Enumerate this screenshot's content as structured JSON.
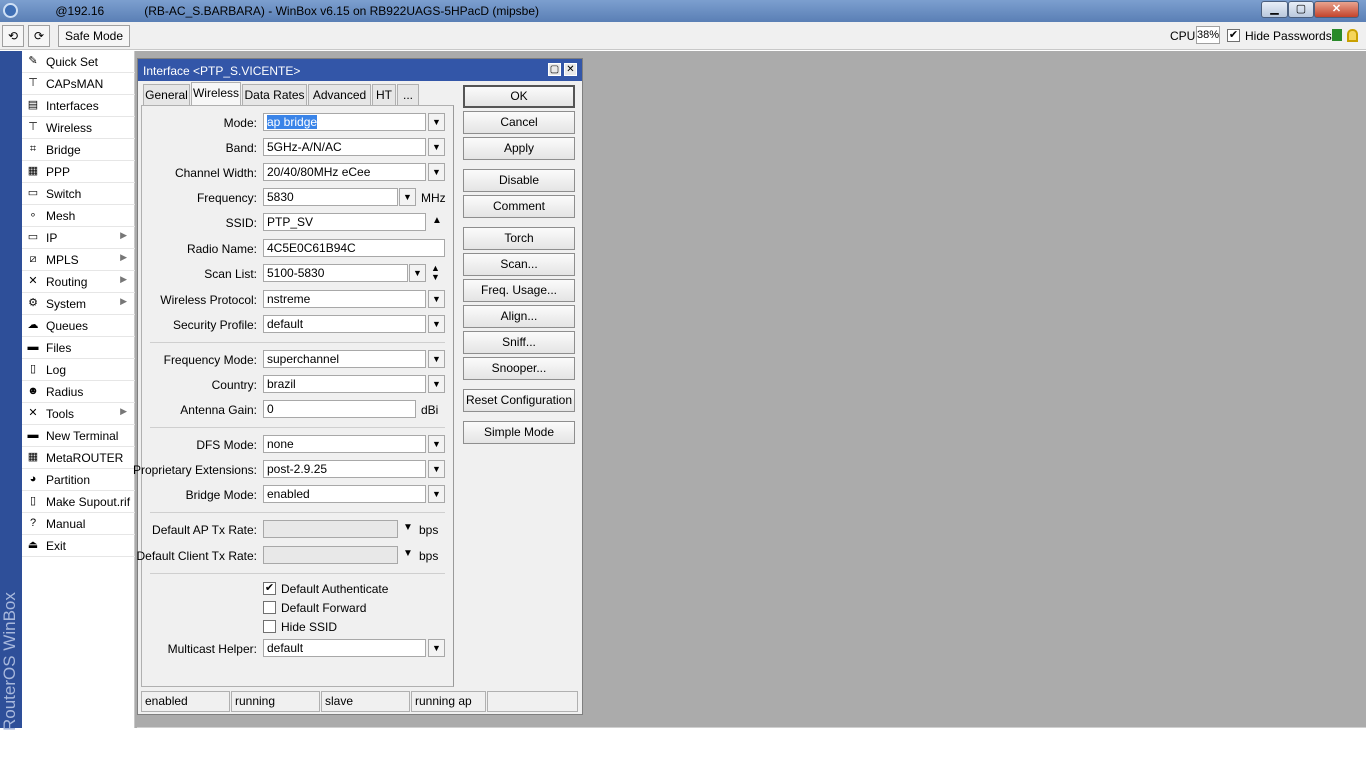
{
  "titlebar": {
    "title": "          @192.16            (RB-AC_S.BARBARA) - WinBox v6.15 on RB922UAGS-5HPacD (mipsbe)"
  },
  "toolbar": {
    "undo": "⟲",
    "redo": "⟳",
    "safe_mode": "Safe Mode",
    "cpu_label": "CPU:",
    "cpu_value": "38%",
    "hide_passwords": "Hide Passwords",
    "hide_passwords_checked": true
  },
  "brand": "RouterOS WinBox",
  "menu": [
    {
      "label": "Quick Set",
      "icon": "quick-set-icon",
      "glyph": "✎",
      "sub": false
    },
    {
      "label": "CAPsMAN",
      "icon": "capsman-icon",
      "glyph": "⊤",
      "sub": false
    },
    {
      "label": "Interfaces",
      "icon": "interfaces-icon",
      "glyph": "▤",
      "sub": false
    },
    {
      "label": "Wireless",
      "icon": "wireless-icon",
      "glyph": "⊤",
      "sub": false
    },
    {
      "label": "Bridge",
      "icon": "bridge-icon",
      "glyph": "⌗",
      "sub": false
    },
    {
      "label": "PPP",
      "icon": "ppp-icon",
      "glyph": "▦",
      "sub": false
    },
    {
      "label": "Switch",
      "icon": "switch-icon",
      "glyph": "▭",
      "sub": false
    },
    {
      "label": "Mesh",
      "icon": "mesh-icon",
      "glyph": "∘",
      "sub": false
    },
    {
      "label": "IP",
      "icon": "ip-icon",
      "glyph": "▭",
      "sub": true
    },
    {
      "label": "MPLS",
      "icon": "mpls-icon",
      "glyph": "⧄",
      "sub": true
    },
    {
      "label": "Routing",
      "icon": "routing-icon",
      "glyph": "✕",
      "sub": true
    },
    {
      "label": "System",
      "icon": "system-icon",
      "glyph": "⚙",
      "sub": true
    },
    {
      "label": "Queues",
      "icon": "queues-icon",
      "glyph": "☁",
      "sub": false
    },
    {
      "label": "Files",
      "icon": "files-icon",
      "glyph": "▬",
      "sub": false
    },
    {
      "label": "Log",
      "icon": "log-icon",
      "glyph": "▯",
      "sub": false
    },
    {
      "label": "Radius",
      "icon": "radius-icon",
      "glyph": "☻",
      "sub": false
    },
    {
      "label": "Tools",
      "icon": "tools-icon",
      "glyph": "✕",
      "sub": true
    },
    {
      "label": "New Terminal",
      "icon": "terminal-icon",
      "glyph": "▬",
      "sub": false
    },
    {
      "label": "MetaROUTER",
      "icon": "metarouter-icon",
      "glyph": "▦",
      "sub": false
    },
    {
      "label": "Partition",
      "icon": "partition-icon",
      "glyph": "◕",
      "sub": false
    },
    {
      "label": "Make Supout.rif",
      "icon": "supout-icon",
      "glyph": "▯",
      "sub": false
    },
    {
      "label": "Manual",
      "icon": "manual-icon",
      "glyph": "?",
      "sub": false
    },
    {
      "label": "Exit",
      "icon": "exit-icon",
      "glyph": "⏏",
      "sub": false
    }
  ],
  "dialog": {
    "title": "Interface <PTP_S.VICENTE>",
    "tabs": [
      "General",
      "Wireless",
      "Data Rates",
      "Advanced",
      "HT",
      "..."
    ],
    "active_tab": "Wireless",
    "fields": {
      "mode": {
        "label": "Mode:",
        "value": "ap bridge"
      },
      "band": {
        "label": "Band:",
        "value": "5GHz-A/N/AC"
      },
      "channel_width": {
        "label": "Channel Width:",
        "value": "20/40/80MHz eCee"
      },
      "frequency": {
        "label": "Frequency:",
        "value": "5830",
        "unit": "MHz"
      },
      "ssid": {
        "label": "SSID:",
        "value": "PTP_SV"
      },
      "radio_name": {
        "label": "Radio Name:",
        "value": "4C5E0C61B94C"
      },
      "scan_list": {
        "label": "Scan List:",
        "value": "5100-5830"
      },
      "wireless_protocol": {
        "label": "Wireless Protocol:",
        "value": "nstreme"
      },
      "security_profile": {
        "label": "Security Profile:",
        "value": "default"
      },
      "frequency_mode": {
        "label": "Frequency Mode:",
        "value": "superchannel"
      },
      "country": {
        "label": "Country:",
        "value": "brazil"
      },
      "antenna_gain": {
        "label": "Antenna Gain:",
        "value": "0",
        "unit": "dBi"
      },
      "dfs_mode": {
        "label": "DFS Mode:",
        "value": "none"
      },
      "proprietary_extensions": {
        "label": "Proprietary Extensions:",
        "value": "post-2.9.25"
      },
      "bridge_mode": {
        "label": "Bridge Mode:",
        "value": "enabled"
      },
      "default_ap_tx_rate": {
        "label": "Default AP Tx Rate:",
        "value": "",
        "unit": "bps"
      },
      "default_client_tx_rate": {
        "label": "Default Client Tx Rate:",
        "value": "",
        "unit": "bps"
      },
      "multicast_helper": {
        "label": "Multicast Helper:",
        "value": "default"
      }
    },
    "checkboxes": {
      "default_authenticate": {
        "label": "Default Authenticate",
        "checked": true
      },
      "default_forward": {
        "label": "Default Forward",
        "checked": false
      },
      "hide_ssid": {
        "label": "Hide SSID",
        "checked": false
      }
    },
    "buttons": [
      "OK",
      "Cancel",
      "Apply",
      "Disable",
      "Comment",
      "Torch",
      "Scan...",
      "Freq. Usage...",
      "Align...",
      "Sniff...",
      "Snooper...",
      "Reset Configuration",
      "Simple Mode"
    ],
    "status": [
      "enabled",
      "running",
      "slave",
      "running ap"
    ]
  }
}
